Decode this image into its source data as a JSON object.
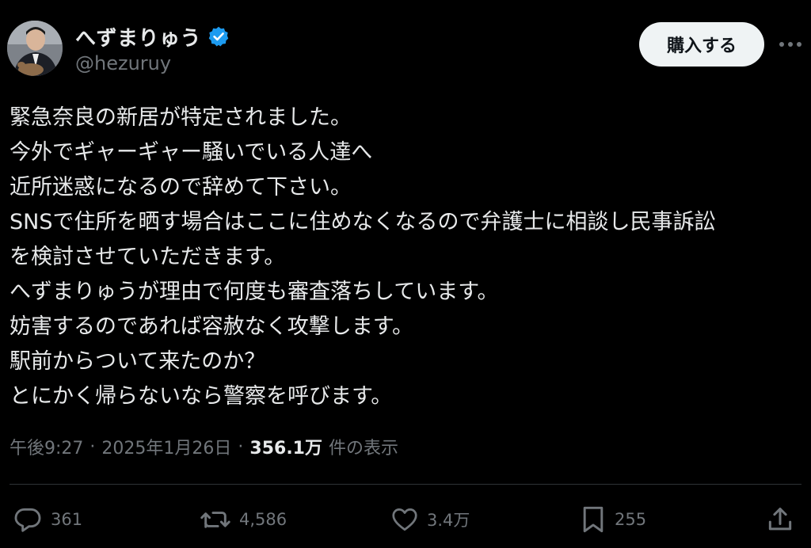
{
  "header": {
    "display_name": "へずまりゅう",
    "handle": "@hezuruy",
    "buy_button_label": "購入する"
  },
  "tweet": {
    "lines": [
      "緊急奈良の新居が特定されました。",
      "今外でギャーギャー騒いでいる人達へ",
      "近所迷惑になるので辞めて下さい。",
      "SNSで住所を晒す場合はここに住めなくなるので弁護士に相談し民事訴訟",
      "を検討させていただきます。",
      "へずまりゅうが理由で何度も審査落ちしています。",
      "妨害するのであれば容赦なく攻撃します。",
      "駅前からついて来たのか？",
      "とにかく帰らないなら警察を呼びます。"
    ]
  },
  "meta": {
    "time": "午後9:27",
    "separator": "·",
    "date": "2025年1月26日",
    "views_count": "356.1万",
    "views_label": "件の表示"
  },
  "actions": {
    "replies": "361",
    "reposts": "4,586",
    "likes": "3.4万",
    "bookmarks": "255"
  },
  "icons": {
    "reply": "reply-icon",
    "repost": "repost-icon",
    "like": "heart-icon",
    "bookmark": "bookmark-icon",
    "share": "share-icon",
    "more": "more-icon",
    "verified": "verified-badge-icon"
  },
  "colors": {
    "background": "#000000",
    "text_primary": "#e7e9ea",
    "text_secondary": "#71767b",
    "verified_blue": "#1d9bf0",
    "button_bg": "#eff3f4",
    "divider": "#2f3336"
  }
}
